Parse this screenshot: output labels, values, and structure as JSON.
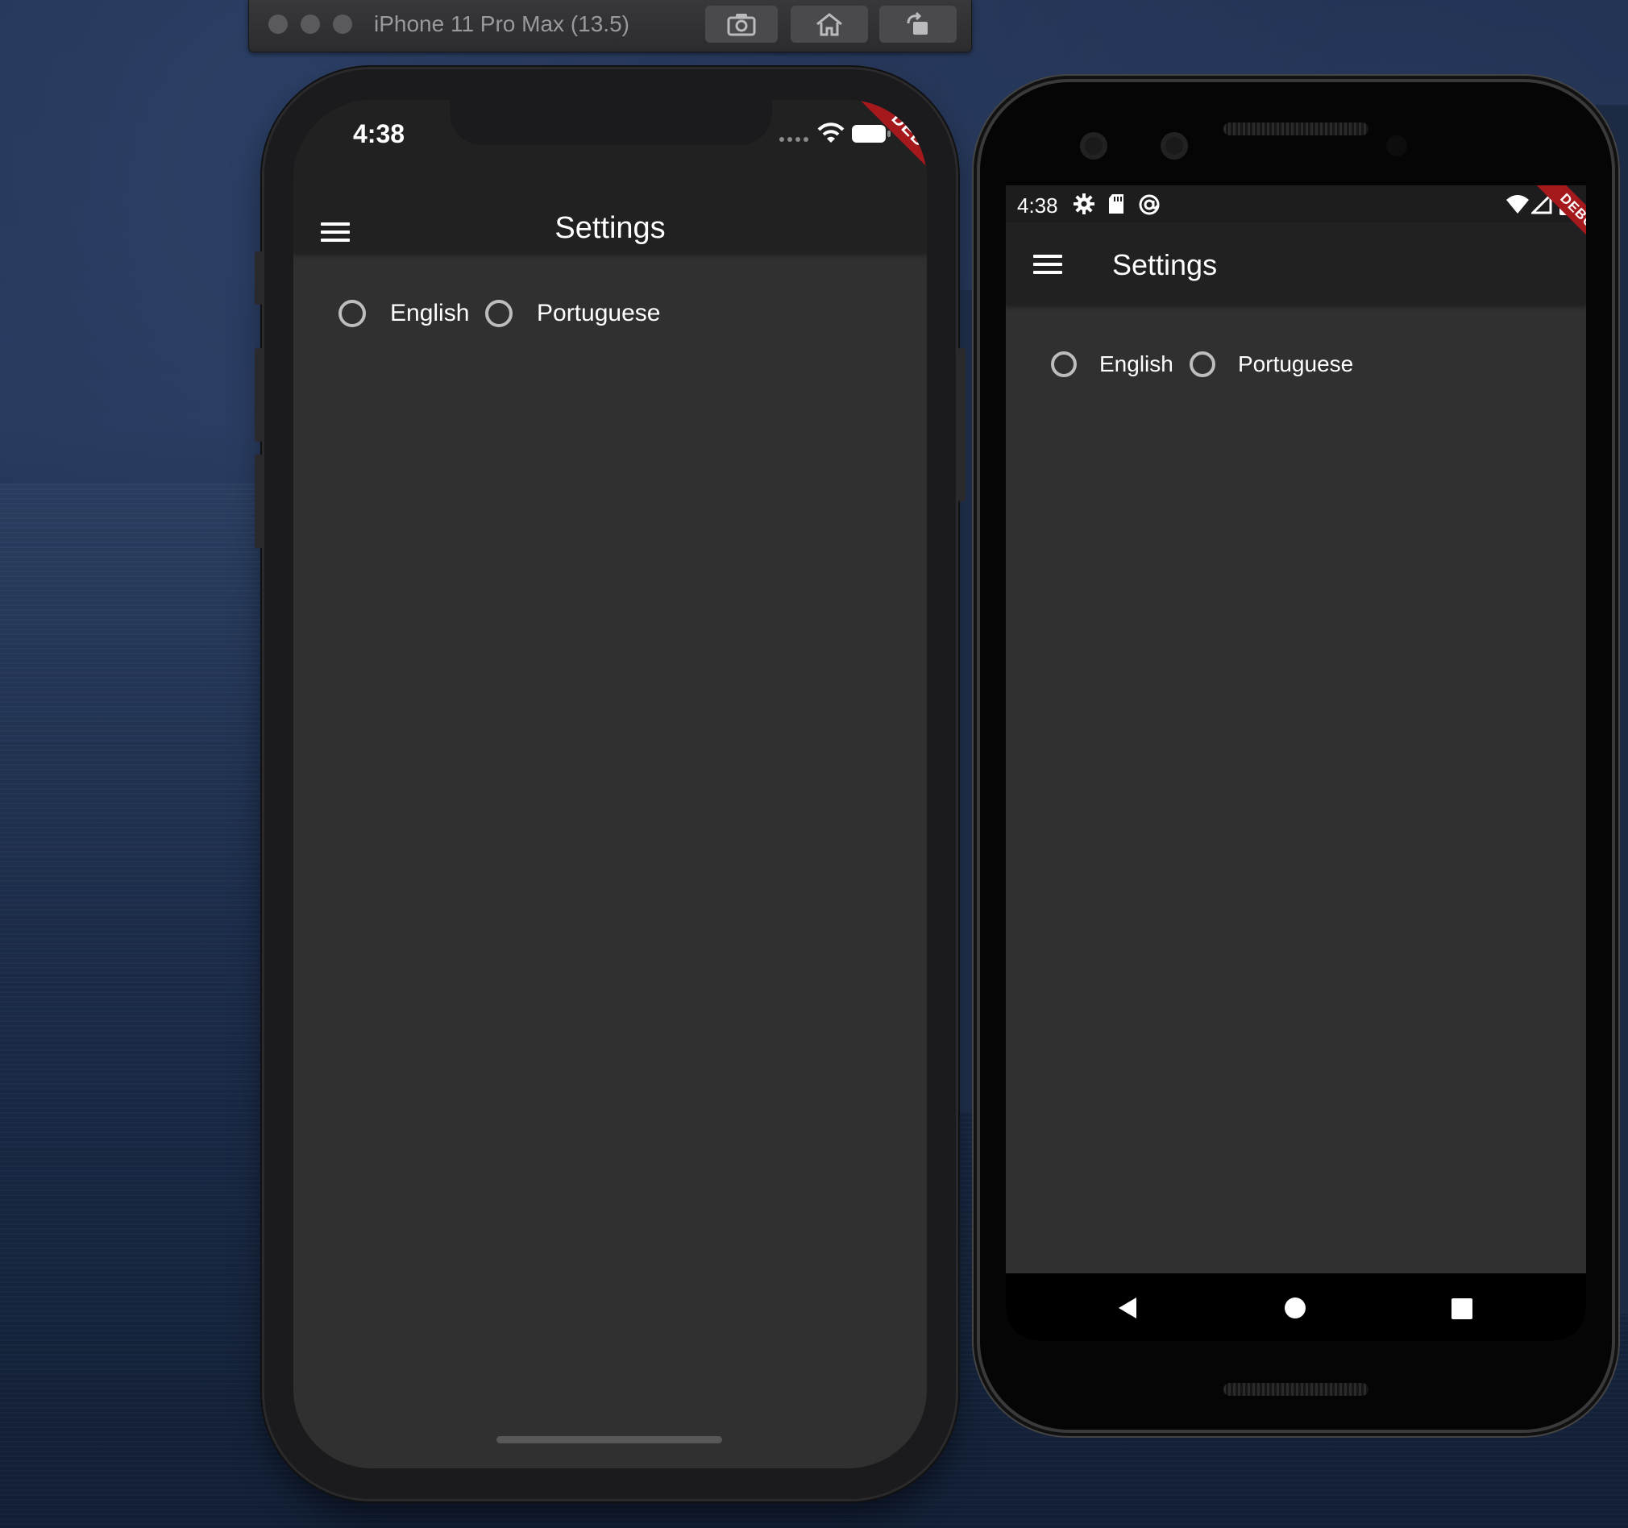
{
  "simulator": {
    "title": "iPhone 11 Pro Max (13.5)",
    "buttons": [
      "screenshot-icon",
      "home-icon",
      "rotate-icon"
    ]
  },
  "ios": {
    "status_time": "4:38",
    "appbar_title": "Settings",
    "debug_banner": "DEBUG",
    "radio_options": [
      {
        "label": "English",
        "selected": false
      },
      {
        "label": "Portuguese",
        "selected": false
      }
    ]
  },
  "android": {
    "status_time": "4:38",
    "status_icons": [
      "gear-icon",
      "sd-card-icon",
      "at-sign-icon",
      "wifi-icon",
      "signal-icon",
      "battery-icon"
    ],
    "appbar_title": "Settings",
    "debug_banner": "DEBUG",
    "radio_options": [
      {
        "label": "English",
        "selected": false
      },
      {
        "label": "Portuguese",
        "selected": false
      }
    ],
    "nav_buttons": [
      "back-icon",
      "home-icon",
      "recents-icon"
    ]
  },
  "colors": {
    "appbar": "#212121",
    "body": "#303030",
    "debug": "#a5191d",
    "radio_border": "#bdbdbd"
  }
}
